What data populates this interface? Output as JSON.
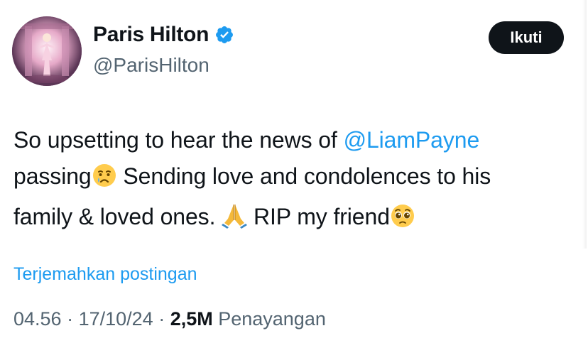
{
  "author": {
    "name": "Paris Hilton",
    "handle": "@ParisHilton",
    "verified": true,
    "verified_color": "#1d9bf0"
  },
  "follow_button": {
    "label": "Ikuti"
  },
  "tweet": {
    "text_1": "So upsetting to hear the news of ",
    "mention": "@LiamPayne",
    "text_2": "passing",
    "emoji_1": "crying-face",
    "text_3": " Sending love and condolences to his",
    "text_4": "family & loved ones. ",
    "emoji_2": "folded-hands",
    "text_5": " RIP my friend",
    "emoji_3": "pleading-face"
  },
  "translate_link": "Terjemahkan postingan",
  "meta": {
    "time": "04.56",
    "sep1": " · ",
    "date": "17/10/24",
    "sep2": " · ",
    "views_count": "2,5M",
    "views_label": " Penayangan"
  },
  "colors": {
    "link": "#1d9bf0",
    "secondary_text": "#536471",
    "primary_text": "#0f1419"
  }
}
